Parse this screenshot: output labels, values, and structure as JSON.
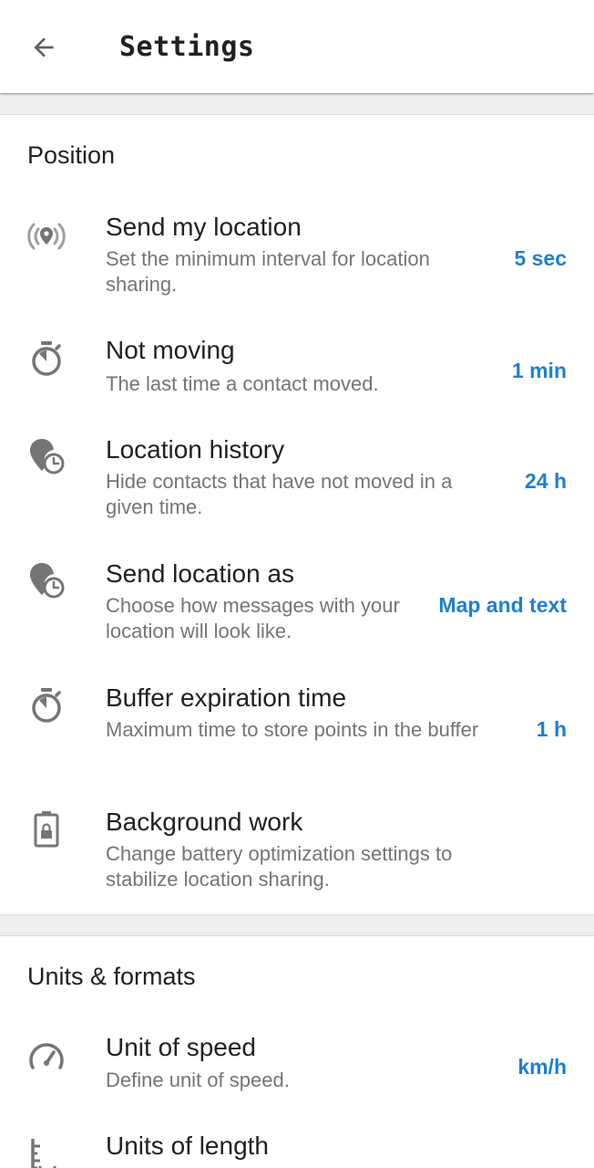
{
  "appbar": {
    "title": "Settings"
  },
  "position_section": {
    "title": "Position",
    "items": [
      {
        "title": "Send my location",
        "summary": "Set the minimum interval for location sharing.",
        "value": "5 sec",
        "icon": "location-broadcast-icon"
      },
      {
        "title": "Not moving",
        "summary": "The last time a contact moved.",
        "value": "1 min",
        "icon": "timer-icon"
      },
      {
        "title": "Location history",
        "summary": "Hide contacts that have not moved in a given time.",
        "value": "24 h",
        "icon": "location-history-icon"
      },
      {
        "title": "Send location as",
        "summary": "Choose how messages with your location will look like.",
        "value": "Map and text",
        "icon": "location-history-icon"
      },
      {
        "title": "Buffer expiration time",
        "summary": "Maximum time to store points in the buffer",
        "value": "1 h",
        "icon": "timer-icon"
      },
      {
        "title": "Background work",
        "summary": "Change battery optimization settings to stabilize location sharing.",
        "value": "",
        "icon": "battery-lock-icon"
      }
    ]
  },
  "units_section": {
    "title": "Units & formats",
    "items": [
      {
        "title": "Unit of speed",
        "summary": "Define unit of speed.",
        "value": "km/h",
        "icon": "speedometer-icon"
      },
      {
        "title": "Units of length",
        "summary": "",
        "value": "",
        "icon": "ruler-icon"
      }
    ]
  },
  "colors": {
    "accent": "#1e7fd2",
    "title_text": "#212121",
    "summary_text": "#757575",
    "divider": "#efefef"
  }
}
